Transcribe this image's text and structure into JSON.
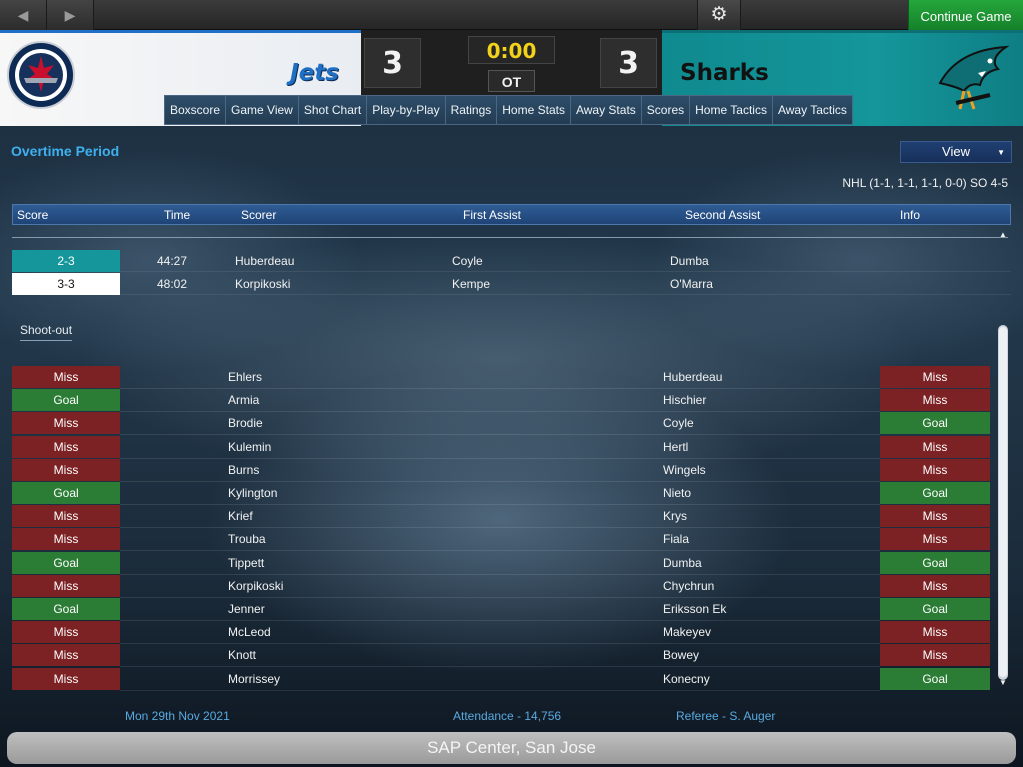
{
  "topbar": {
    "back_icon": "chevron-left-icon",
    "forward_icon": "chevron-right-icon",
    "settings_icon": "gear-icon",
    "continue_label": "Continue Game"
  },
  "scoreboard": {
    "home_team": "Jets",
    "away_team": "Sharks",
    "home_score": "3",
    "away_score": "3",
    "clock": "0:00",
    "period": "OT"
  },
  "tabs": [
    "Boxscore",
    "Game View",
    "Shot Chart",
    "Play-by-Play",
    "Ratings",
    "Home Stats",
    "Away Stats",
    "Scores",
    "Home Tactics",
    "Away Tactics"
  ],
  "section": {
    "title": "Overtime Period",
    "view_label": "View",
    "series_info": "NHL (1-1, 1-1, 1-1, 0-0) SO 4-5"
  },
  "goals_table": {
    "columns": [
      "Score",
      "Time",
      "Scorer",
      "First Assist",
      "Second Assist",
      "Info"
    ],
    "rows": [
      {
        "score": "2-3",
        "time": "44:27",
        "scorer": "Huberdeau",
        "first_assist": "Coyle",
        "second_assist": "Dumba",
        "team": "away"
      },
      {
        "score": "3-3",
        "time": "48:02",
        "scorer": "Korpikoski",
        "first_assist": "Kempe",
        "second_assist": "O'Marra",
        "team": "home"
      }
    ]
  },
  "shootout": {
    "tab_label": "Shoot-out",
    "rows": [
      {
        "home_result": "Miss",
        "home_player": "Ehlers",
        "away_player": "Huberdeau",
        "away_result": "Miss"
      },
      {
        "home_result": "Goal",
        "home_player": "Armia",
        "away_player": "Hischier",
        "away_result": "Miss"
      },
      {
        "home_result": "Miss",
        "home_player": "Brodie",
        "away_player": "Coyle",
        "away_result": "Goal"
      },
      {
        "home_result": "Miss",
        "home_player": "Kulemin",
        "away_player": "Hertl",
        "away_result": "Miss"
      },
      {
        "home_result": "Miss",
        "home_player": "Burns",
        "away_player": "Wingels",
        "away_result": "Miss"
      },
      {
        "home_result": "Goal",
        "home_player": "Kylington",
        "away_player": "Nieto",
        "away_result": "Goal"
      },
      {
        "home_result": "Miss",
        "home_player": "Krief",
        "away_player": "Krys",
        "away_result": "Miss"
      },
      {
        "home_result": "Miss",
        "home_player": "Trouba",
        "away_player": "Fiala",
        "away_result": "Miss"
      },
      {
        "home_result": "Goal",
        "home_player": "Tippett",
        "away_player": "Dumba",
        "away_result": "Goal"
      },
      {
        "home_result": "Miss",
        "home_player": "Korpikoski",
        "away_player": "Chychrun",
        "away_result": "Miss"
      },
      {
        "home_result": "Goal",
        "home_player": "Jenner",
        "away_player": "Eriksson Ek",
        "away_result": "Goal"
      },
      {
        "home_result": "Miss",
        "home_player": "McLeod",
        "away_player": "Makeyev",
        "away_result": "Miss"
      },
      {
        "home_result": "Miss",
        "home_player": "Knott",
        "away_player": "Bowey",
        "away_result": "Miss"
      },
      {
        "home_result": "Miss",
        "home_player": "Morrissey",
        "away_player": "Konecny",
        "away_result": "Goal"
      }
    ]
  },
  "footer": {
    "date": "Mon 29th Nov 2021",
    "attendance": "Attendance - 14,756",
    "referee": "Referee - S. Auger",
    "venue": "SAP Center, San Jose"
  },
  "colors": {
    "miss": "#7c2224",
    "goal": "#2b7d35",
    "away_teal": "#14969a",
    "home_blue": "#1f6fc4",
    "title_blue": "#3fb0ef"
  }
}
